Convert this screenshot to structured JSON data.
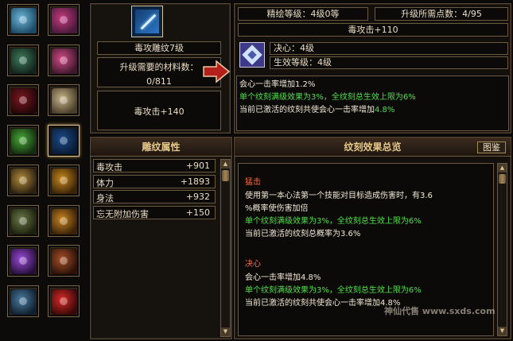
{
  "slots": [
    {
      "icon": "ring-band-icon",
      "selected": false
    },
    {
      "icon": "flower-ring-icon",
      "selected": false
    },
    {
      "icon": "armor-icon",
      "selected": false
    },
    {
      "icon": "flower-ring-icon",
      "selected": false
    },
    {
      "icon": "boots-icon",
      "selected": false
    },
    {
      "icon": "bracer-icon",
      "selected": false
    },
    {
      "icon": "sword-icon",
      "selected": false
    },
    {
      "icon": "blue-blade-icon",
      "selected": true
    },
    {
      "icon": "curtain-icon",
      "selected": false
    },
    {
      "icon": "belt-icon",
      "selected": false
    },
    {
      "icon": "jade-disc-icon",
      "selected": false
    },
    {
      "icon": "pouch-icon",
      "selected": false
    },
    {
      "icon": "purple-blade-icon",
      "selected": false
    },
    {
      "icon": "necklace-icon",
      "selected": false
    },
    {
      "icon": "helmet-icon",
      "selected": false
    },
    {
      "icon": "red-gem-icon",
      "selected": false
    }
  ],
  "item": {
    "name": "毒攻雕纹7级",
    "materials_label": "升级需要的材料数：",
    "materials_value": "0/811",
    "bonus": "毒攻击+140"
  },
  "upgrade": {
    "level": "精绘等级：4级0等",
    "points": "升级所需点数：4/95",
    "target_bonus": "毒攻击+110",
    "resolve": "决心：4级",
    "effect_level": "生效等级：4级",
    "lines": [
      {
        "text": "会心一击率增加1.2%",
        "color": "white"
      },
      {
        "text": "单个纹刻满级效果为3%，全纹刻总生效上限为6%",
        "color": "green"
      },
      {
        "text": "当前已激活的纹刻共使会心一击率增加4.8%",
        "color": "white",
        "highlight": "4.8%"
      }
    ]
  },
  "attrs": {
    "title": "雕纹属性",
    "rows": [
      {
        "name": "毒攻击",
        "value": "+901"
      },
      {
        "name": "体力",
        "value": "+1893"
      },
      {
        "name": "身法",
        "value": "+932"
      },
      {
        "name": "忘无附加伤害",
        "value": "+150"
      }
    ]
  },
  "overview": {
    "title": "纹刻效果总览",
    "tujian": "图鉴",
    "sections": [
      {
        "heading": "猛击",
        "lines": [
          {
            "text": "使用第一本心法第一个技能对目标造成伤害时，有3.6",
            "color": "white"
          },
          {
            "text": "%概率使伤害加倍",
            "color": "white"
          },
          {
            "text": "单个纹刻满级效果为3%，全纹刻总生效上限为6%",
            "color": "green"
          },
          {
            "text": "当前已激活的纹刻总概率为3.6%",
            "color": "white"
          }
        ]
      },
      {
        "heading": "决心",
        "lines": [
          {
            "text": "会心一击率增加4.8%",
            "color": "white"
          },
          {
            "text": "单个纹刻满级效果为3%，全纹刻总生效上限为6%",
            "color": "green"
          },
          {
            "text": "当前已激活的纹刻共使会心一击率增加4.8%",
            "color": "white"
          }
        ]
      }
    ]
  },
  "watermark": "神仙代售 www.sxds.com"
}
